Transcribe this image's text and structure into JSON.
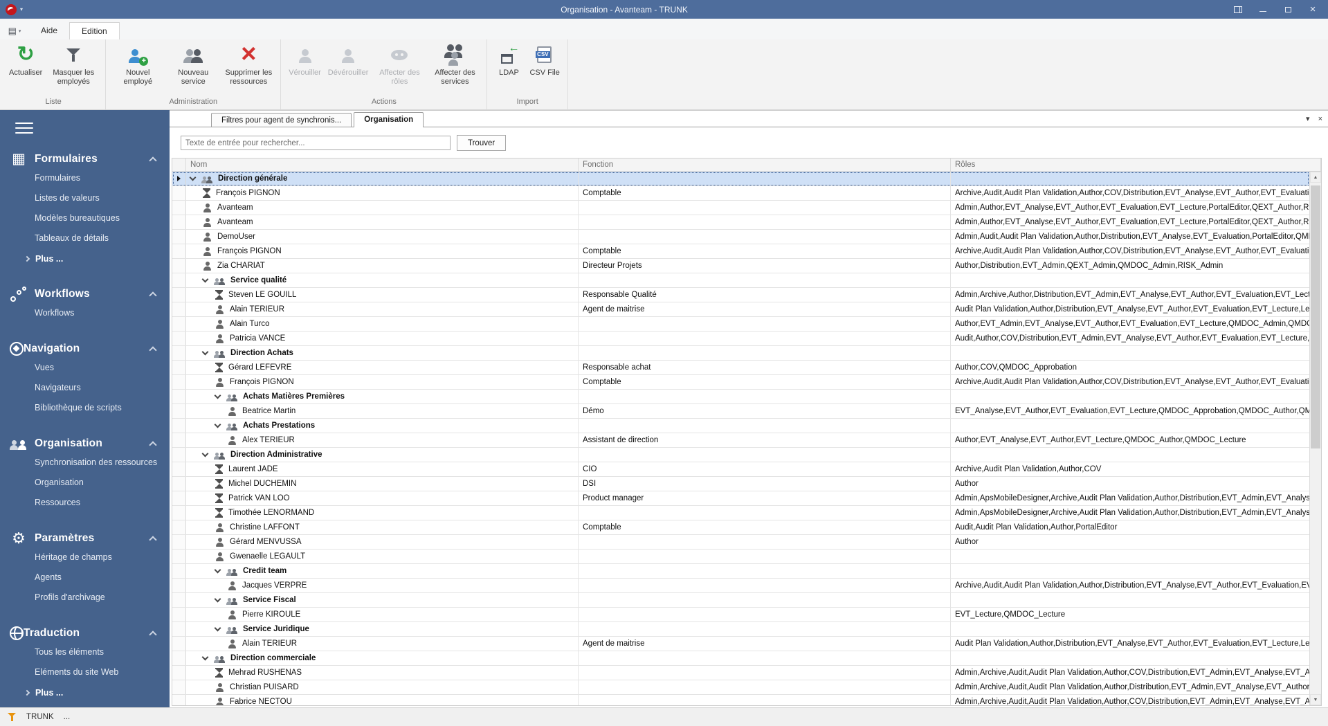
{
  "window": {
    "title": "Organisation - Avanteam - TRUNK"
  },
  "menu_tabs": {
    "aide": "Aide",
    "edition": "Edition"
  },
  "ribbon": {
    "groups": [
      {
        "label": "Liste",
        "buttons": [
          {
            "label": "Actualiser",
            "icon": "refresh-icon",
            "disabled": false
          },
          {
            "label": "Masquer les employés",
            "icon": "filter-icon",
            "disabled": false
          }
        ]
      },
      {
        "label": "Administration",
        "buttons": [
          {
            "label": "Nouvel employé",
            "icon": "new-employee-icon",
            "disabled": false
          },
          {
            "label": "Nouveau service",
            "icon": "new-service-icon",
            "disabled": false
          },
          {
            "label": "Supprimer les ressources",
            "icon": "delete-resources-icon",
            "disabled": false
          }
        ]
      },
      {
        "label": "Actions",
        "buttons": [
          {
            "label": "Vérouiller",
            "icon": "lock-user-icon",
            "disabled": true
          },
          {
            "label": "Dévérouiller",
            "icon": "unlock-user-icon",
            "disabled": true
          },
          {
            "label": "Affecter des rôles",
            "icon": "assign-roles-mask-icon",
            "disabled": true
          },
          {
            "label": "Affecter des services",
            "icon": "assign-services-icon",
            "disabled": false
          }
        ]
      },
      {
        "label": "Import",
        "buttons": [
          {
            "label": "LDAP",
            "icon": "ldap-import-icon",
            "disabled": false
          },
          {
            "label": "CSV File",
            "icon": "csv-file-icon",
            "disabled": false
          }
        ]
      }
    ]
  },
  "sidebar": {
    "sections": [
      {
        "title": "Formulaires",
        "icon": "table-icon",
        "items": [
          "Formulaires",
          "Listes de valeurs",
          "Modèles bureautiques",
          "Tableaux de détails"
        ],
        "more": "Plus ..."
      },
      {
        "title": "Workflows",
        "icon": "workflow-icon",
        "items": [
          "Workflows"
        ]
      },
      {
        "title": "Navigation",
        "icon": "compass-icon",
        "items": [
          "Vues",
          "Navigateurs",
          "Bibliothèque de scripts"
        ]
      },
      {
        "title": "Organisation",
        "icon": "people-icon",
        "items": [
          "Synchronisation des ressources",
          "Organisation",
          "Ressources"
        ]
      },
      {
        "title": "Paramètres",
        "icon": "gear-icon",
        "items": [
          "Héritage de champs",
          "Agents",
          "Profils d'archivage"
        ]
      },
      {
        "title": "Traduction",
        "icon": "globe-icon",
        "items": [
          "Tous les éléments",
          "Eléments du site Web"
        ],
        "more": "Plus ..."
      }
    ]
  },
  "content": {
    "tabs": [
      {
        "label": "Filtres pour agent de synchronis...",
        "active": false
      },
      {
        "label": "Organisation",
        "active": true
      }
    ],
    "search": {
      "placeholder": "Texte de entrée pour rechercher...",
      "button": "Trouver"
    },
    "table": {
      "columns": [
        "Nom",
        "Fonction",
        "Rôles"
      ],
      "rows": [
        {
          "type": "group",
          "level": 0,
          "name": "Direction générale",
          "fonction": "",
          "roles": "",
          "selected": true
        },
        {
          "type": "user-busy",
          "level": 1,
          "name": "François PIGNON",
          "fonction": "Comptable",
          "roles": "Archive,Audit,Audit Plan Validation,Author,COV,Distribution,EVT_Analyse,EVT_Author,EVT_Evaluation,EV..."
        },
        {
          "type": "user",
          "level": 1,
          "name": "Avanteam",
          "fonction": "",
          "roles": "Admin,Author,EVT_Analyse,EVT_Author,EVT_Evaluation,EVT_Lecture,PortalEditor,QEXT_Author,RISK_Le..."
        },
        {
          "type": "user",
          "level": 1,
          "name": "Avanteam",
          "fonction": "",
          "roles": "Admin,Author,EVT_Analyse,EVT_Author,EVT_Evaluation,EVT_Lecture,PortalEditor,QEXT_Author,RISK_Le..."
        },
        {
          "type": "user",
          "level": 1,
          "name": "DemoUser",
          "fonction": "",
          "roles": "Admin,Audit,Audit Plan Validation,Author,Distribution,EVT_Analyse,EVT_Evaluation,PortalEditor,QMDOC_..."
        },
        {
          "type": "user",
          "level": 1,
          "name": "François PIGNON",
          "fonction": "Comptable",
          "roles": "Archive,Audit,Audit Plan Validation,Author,COV,Distribution,EVT_Analyse,EVT_Author,EVT_Evaluation,EV..."
        },
        {
          "type": "user",
          "level": 1,
          "name": "Zia CHARIAT",
          "fonction": "Directeur Projets",
          "roles": "Author,Distribution,EVT_Admin,QEXT_Admin,QMDOC_Admin,RISK_Admin"
        },
        {
          "type": "group",
          "level": 1,
          "name": "Service qualité",
          "fonction": "",
          "roles": ""
        },
        {
          "type": "user-busy",
          "level": 2,
          "name": "Steven LE GOUILL",
          "fonction": "Responsable Qualité",
          "roles": "Admin,Archive,Author,Distribution,EVT_Admin,EVT_Analyse,EVT_Author,EVT_Evaluation,EVT_Lecture,QE..."
        },
        {
          "type": "user",
          "level": 2,
          "name": "Alain TERIEUR",
          "fonction": "Agent de maitrise",
          "roles": "Audit Plan Validation,Author,Distribution,EVT_Analyse,EVT_Author,EVT_Evaluation,EVT_Lecture,LectureS..."
        },
        {
          "type": "user",
          "level": 2,
          "name": "Alain Turco",
          "fonction": "",
          "roles": "Author,EVT_Admin,EVT_Analyse,EVT_Author,EVT_Evaluation,EVT_Lecture,QMDOC_Admin,QMDOC_Appr..."
        },
        {
          "type": "user",
          "level": 2,
          "name": "Patricia VANCE",
          "fonction": "",
          "roles": "Audit,Author,COV,Distribution,EVT_Admin,EVT_Analyse,EVT_Author,EVT_Evaluation,EVT_Lecture,PortalE..."
        },
        {
          "type": "group",
          "level": 1,
          "name": "Direction Achats",
          "fonction": "",
          "roles": ""
        },
        {
          "type": "user-busy",
          "level": 2,
          "name": "Gérard LEFEVRE",
          "fonction": "Responsable achat",
          "roles": "Author,COV,QMDOC_Approbation"
        },
        {
          "type": "user",
          "level": 2,
          "name": "François PIGNON",
          "fonction": "Comptable",
          "roles": "Archive,Audit,Audit Plan Validation,Author,COV,Distribution,EVT_Analyse,EVT_Author,EVT_Evaluation,EV..."
        },
        {
          "type": "group",
          "level": 2,
          "name": "Achats Matières Premières",
          "fonction": "",
          "roles": ""
        },
        {
          "type": "user",
          "level": 3,
          "name": "Beatrice Martin",
          "fonction": "Démo",
          "roles": "EVT_Analyse,EVT_Author,EVT_Evaluation,EVT_Lecture,QMDOC_Approbation,QMDOC_Author,QMDOC_L..."
        },
        {
          "type": "group",
          "level": 2,
          "name": "Achats Prestations",
          "fonction": "",
          "roles": ""
        },
        {
          "type": "user",
          "level": 3,
          "name": "Alex TERIEUR",
          "fonction": "Assistant de direction",
          "roles": "Author,EVT_Analyse,EVT_Author,EVT_Lecture,QMDOC_Author,QMDOC_Lecture"
        },
        {
          "type": "group",
          "level": 1,
          "name": "Direction Administrative",
          "fonction": "",
          "roles": ""
        },
        {
          "type": "user-busy",
          "level": 2,
          "name": "Laurent JADE",
          "fonction": "CIO",
          "roles": "Archive,Audit Plan Validation,Author,COV"
        },
        {
          "type": "user-busy",
          "level": 2,
          "name": "Michel DUCHEMIN",
          "fonction": "DSI",
          "roles": "Author"
        },
        {
          "type": "user-busy",
          "level": 2,
          "name": "Patrick VAN LOO",
          "fonction": "Product manager",
          "roles": "Admin,ApsMobileDesigner,Archive,Audit Plan Validation,Author,Distribution,EVT_Admin,EVT_Analyse,EVT_..."
        },
        {
          "type": "user-busy",
          "level": 2,
          "name": "Timothée LENORMAND",
          "fonction": "",
          "roles": "Admin,ApsMobileDesigner,Archive,Audit Plan Validation,Author,Distribution,EVT_Admin,EVT_Analyse,EVT_..."
        },
        {
          "type": "user",
          "level": 2,
          "name": "Christine LAFFONT",
          "fonction": "Comptable",
          "roles": "Audit,Audit Plan Validation,Author,PortalEditor"
        },
        {
          "type": "user",
          "level": 2,
          "name": "Gérard MENVUSSA",
          "fonction": "",
          "roles": "Author"
        },
        {
          "type": "user",
          "level": 2,
          "name": "Gwenaelle LEGAULT",
          "fonction": "",
          "roles": ""
        },
        {
          "type": "group",
          "level": 2,
          "name": "Credit team",
          "fonction": "",
          "roles": ""
        },
        {
          "type": "user",
          "level": 3,
          "name": "Jacques VERPRE",
          "fonction": "",
          "roles": "Archive,Audit,Audit Plan Validation,Author,Distribution,EVT_Analyse,EVT_Author,EVT_Evaluation,EVT_Lec..."
        },
        {
          "type": "group",
          "level": 2,
          "name": "Service Fiscal",
          "fonction": "",
          "roles": ""
        },
        {
          "type": "user",
          "level": 3,
          "name": "Pierre KIROULE",
          "fonction": "",
          "roles": "EVT_Lecture,QMDOC_Lecture"
        },
        {
          "type": "group",
          "level": 2,
          "name": "Service Juridique",
          "fonction": "",
          "roles": ""
        },
        {
          "type": "user",
          "level": 3,
          "name": "Alain TERIEUR",
          "fonction": "Agent de maitrise",
          "roles": "Audit Plan Validation,Author,Distribution,EVT_Analyse,EVT_Author,EVT_Evaluation,EVT_Lecture,LectureS..."
        },
        {
          "type": "group",
          "level": 1,
          "name": "Direction commerciale",
          "fonction": "",
          "roles": ""
        },
        {
          "type": "user-busy",
          "level": 2,
          "name": "Mehrad RUSHENAS",
          "fonction": "",
          "roles": "Admin,Archive,Audit,Audit Plan Validation,Author,COV,Distribution,EVT_Admin,EVT_Analyse,EVT_Author,..."
        },
        {
          "type": "user",
          "level": 2,
          "name": "Christian PUISARD",
          "fonction": "",
          "roles": "Admin,Archive,Audit,Audit Plan Validation,Author,Distribution,EVT_Admin,EVT_Analyse,EVT_Author,EVT_..."
        },
        {
          "type": "user",
          "level": 2,
          "name": "Fabrice NECTOU",
          "fonction": "",
          "roles": "Admin,Archive,Audit,Audit Plan Validation,Author,COV,Distribution,EVT_Admin,EVT_Analyse,EVT_Author,..."
        }
      ]
    }
  },
  "statusbar": {
    "app": "TRUNK",
    "ellipsis": "..."
  }
}
